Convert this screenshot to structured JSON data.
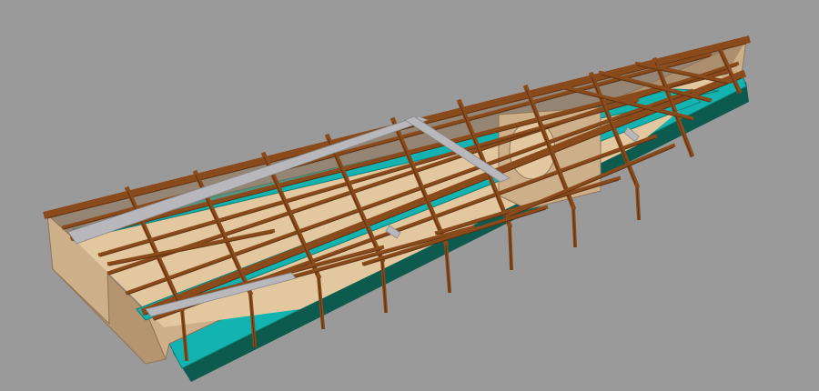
{
  "scene": {
    "subject": "boat-hull-frame-render",
    "colors": {
      "background": "#9a9a9a",
      "plywood": "#cdb08a",
      "plywood_dark": "#b59470",
      "plywood_shadow": "#8f7458",
      "frame": "#8a4b1c",
      "frame_dark": "#5e3010",
      "teal": "#12b3b0",
      "teal_dark": "#0f7e76",
      "keel": "#0d5a4e",
      "steel": "#b8b8bc",
      "floor": "#e2c79f"
    }
  }
}
